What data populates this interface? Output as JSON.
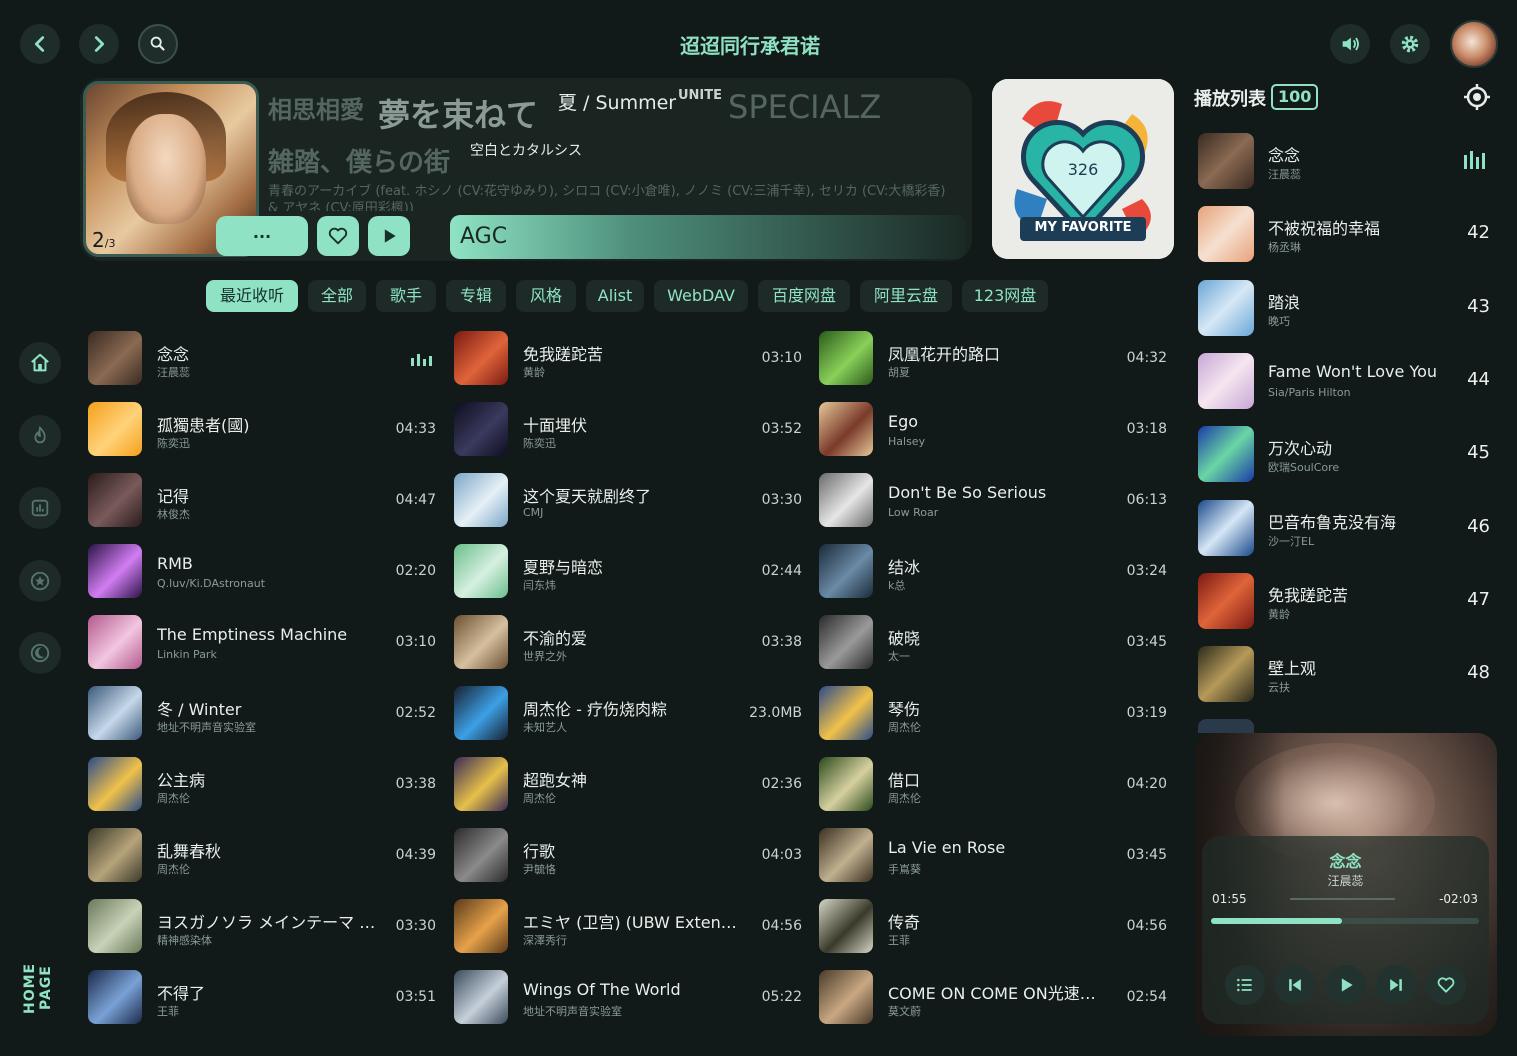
{
  "header": {
    "title": "迢迢同行承君诺",
    "icons": [
      "chevron-left-icon",
      "chevron-right-icon",
      "search-icon",
      "volume-icon",
      "gear-icon",
      "avatar"
    ]
  },
  "hero": {
    "page_current": "2",
    "page_total": "3",
    "tags": [
      "相思相愛",
      "夢を束ねて",
      "夏 / Summer",
      "UNITE",
      "SPECIALZ",
      "雑踏、僕らの街",
      "空白とカタルシス",
      "青春のアーカイブ (feat. ホシノ (CV:花守ゆみり), シロコ (CV:小倉唯), ノノミ (CV:三浦千幸), セリカ (CV:大橋彩香) & アヤネ (CV:原田彩楓))"
    ],
    "more_label": "···",
    "agc_label": "AGC",
    "favorite_count": "326",
    "favorite_label": "MY FAVORITE"
  },
  "filters": [
    "最近收听",
    "全部",
    "歌手",
    "专辑",
    "风格",
    "Alist",
    "WebDAV",
    "百度网盘",
    "阿里云盘",
    "123网盘"
  ],
  "side_nav": {
    "items": [
      "home-icon",
      "fire-icon",
      "chart-icon",
      "star-icon",
      "moon-icon"
    ],
    "label": "HOME PAGE"
  },
  "songs": [
    [
      {
        "title": "念念",
        "artist": "汪晨蕊",
        "duration": ""
      },
      {
        "title": "孤獨患者(國)",
        "artist": "陈奕迅",
        "duration": "04:33"
      },
      {
        "title": "记得",
        "artist": "林俊杰",
        "duration": "04:47"
      },
      {
        "title": "RMB",
        "artist": "Q.luv/Ki.DAstronaut",
        "duration": "02:20"
      },
      {
        "title": "The Emptiness Machine",
        "artist": "Linkin Park",
        "duration": "03:10"
      },
      {
        "title": "冬 / Winter",
        "artist": "地址不明声音实验室",
        "duration": "02:52"
      },
      {
        "title": "公主病",
        "artist": "周杰伦",
        "duration": "03:38"
      },
      {
        "title": "乱舞春秋",
        "artist": "周杰伦",
        "duration": "04:39"
      },
      {
        "title": "ヨスガノソラ メインテーマ -遠い空へ-",
        "artist": "精神感染体",
        "duration": "03:30"
      },
      {
        "title": "不得了",
        "artist": "王菲",
        "duration": "03:51"
      }
    ],
    [
      {
        "title": "免我蹉跎苦",
        "artist": "黄龄",
        "duration": "03:10"
      },
      {
        "title": "十面埋伏",
        "artist": "陈奕迅",
        "duration": "03:52"
      },
      {
        "title": "这个夏天就剧终了",
        "artist": "CMJ",
        "duration": "03:30"
      },
      {
        "title": "夏野与暗恋",
        "artist": "闫东炜",
        "duration": "02:44"
      },
      {
        "title": "不渝的爱",
        "artist": "世界之外",
        "duration": "03:38"
      },
      {
        "title": "周杰伦 - 疗伤烧肉粽",
        "artist": "未知艺人",
        "duration": "23.0MB"
      },
      {
        "title": "超跑女神",
        "artist": "周杰伦",
        "duration": "02:36"
      },
      {
        "title": "行歌",
        "artist": "尹毓恪",
        "duration": "04:03"
      },
      {
        "title": "エミヤ (卫宫) (UBW Extended Version)",
        "artist": "深澤秀行",
        "duration": "04:56"
      },
      {
        "title": "Wings Of The World",
        "artist": "地址不明声音实验室",
        "duration": "05:22"
      }
    ],
    [
      {
        "title": "凤凰花开的路口",
        "artist": "胡夏",
        "duration": "04:32"
      },
      {
        "title": "Ego",
        "artist": "Halsey",
        "duration": "03:18"
      },
      {
        "title": "Don't Be So Serious",
        "artist": "Low Roar",
        "duration": "06:13"
      },
      {
        "title": "结冰",
        "artist": "k总",
        "duration": "03:24"
      },
      {
        "title": "破晓",
        "artist": "太一",
        "duration": "03:45"
      },
      {
        "title": "琴伤",
        "artist": "周杰伦",
        "duration": "03:19"
      },
      {
        "title": "借口",
        "artist": "周杰伦",
        "duration": "04:20"
      },
      {
        "title": "La Vie en Rose",
        "artist": "手嶌葵",
        "duration": "03:45"
      },
      {
        "title": "传奇",
        "artist": "王菲",
        "duration": "04:56"
      },
      {
        "title": "COME ON COME ON光速飛翔",
        "artist": "莫文蔚",
        "duration": "02:54"
      }
    ]
  ],
  "playlist": {
    "title": "播放列表",
    "count": "100",
    "items": [
      {
        "title": "念念",
        "artist": "汪晨蕊",
        "num": ""
      },
      {
        "title": "不被祝福的幸福",
        "artist": "杨丞琳",
        "num": "42"
      },
      {
        "title": "踏浪",
        "artist": "晚巧",
        "num": "43"
      },
      {
        "title": "Fame Won't Love You",
        "artist": "Sia/Paris Hilton",
        "num": "44"
      },
      {
        "title": "万次心动",
        "artist": "欧瑞SoulCore",
        "num": "45"
      },
      {
        "title": "巴音布鲁克没有海",
        "artist": "沙一汀EL",
        "num": "46"
      },
      {
        "title": "免我蹉跎苦",
        "artist": "黄龄",
        "num": "47"
      },
      {
        "title": "壁上观",
        "artist": "云扶",
        "num": "48"
      }
    ]
  },
  "now_playing": {
    "title": "念念",
    "artist": "汪晨蕊",
    "elapsed": "01:55",
    "remaining": "-02:03",
    "progress": 0.49
  },
  "colors": {
    "accent": "#8fe3c4",
    "background": "#111a18",
    "surface": "#1d2a27"
  }
}
